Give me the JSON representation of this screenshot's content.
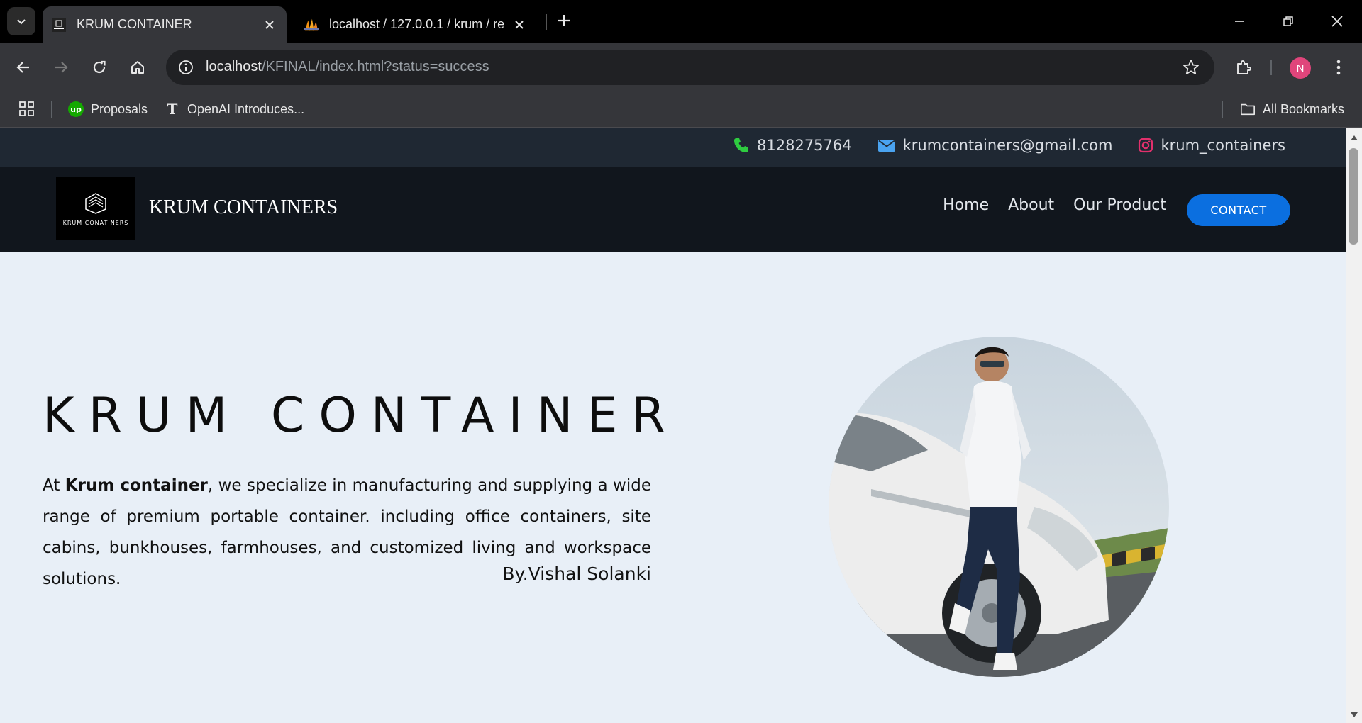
{
  "browser": {
    "tabs": [
      {
        "title": "KRUM CONTAINER",
        "active": true
      },
      {
        "title": "localhost / 127.0.0.1 / krum / re",
        "active": false
      }
    ],
    "url_host": "localhost",
    "url_path": "/KFINAL/index.html?status=success",
    "profile_initial": "N",
    "bookmarks": [
      {
        "label": "Proposals",
        "icon": "upwork-icon"
      },
      {
        "label": "OpenAI Introduces...",
        "icon": "nyt-icon"
      }
    ],
    "all_bookmarks_label": "All Bookmarks"
  },
  "site": {
    "topbar": {
      "phone": "8128275764",
      "email": "krumcontainers@gmail.com",
      "instagram": "krum_containers"
    },
    "nav": {
      "logo_text": "KRUM CONATINERS",
      "brand": "KRUM CONTAINERS",
      "links": [
        "Home",
        "About",
        "Our Product"
      ],
      "cta": "CONTACT"
    },
    "hero": {
      "title": "KRUM CONTAINER",
      "desc_prefix": "At ",
      "desc_bold": "Krum container",
      "desc_rest": ", we specialize in manufacturing and supplying a wide range of premium portable container. including office containers, site cabins, bunkhouses, farmhouses, and customized living and workspace solutions.",
      "author": "By.Vishal Solanki"
    }
  },
  "colors": {
    "topbar_bg": "#1f2833",
    "navbar_bg": "#11161d",
    "page_bg": "#e8eff7",
    "cta_blue": "#0b6fe0",
    "phone_green": "#2ecc40",
    "mail_blue": "#4aa3f0",
    "insta_red": "#e1306c"
  }
}
